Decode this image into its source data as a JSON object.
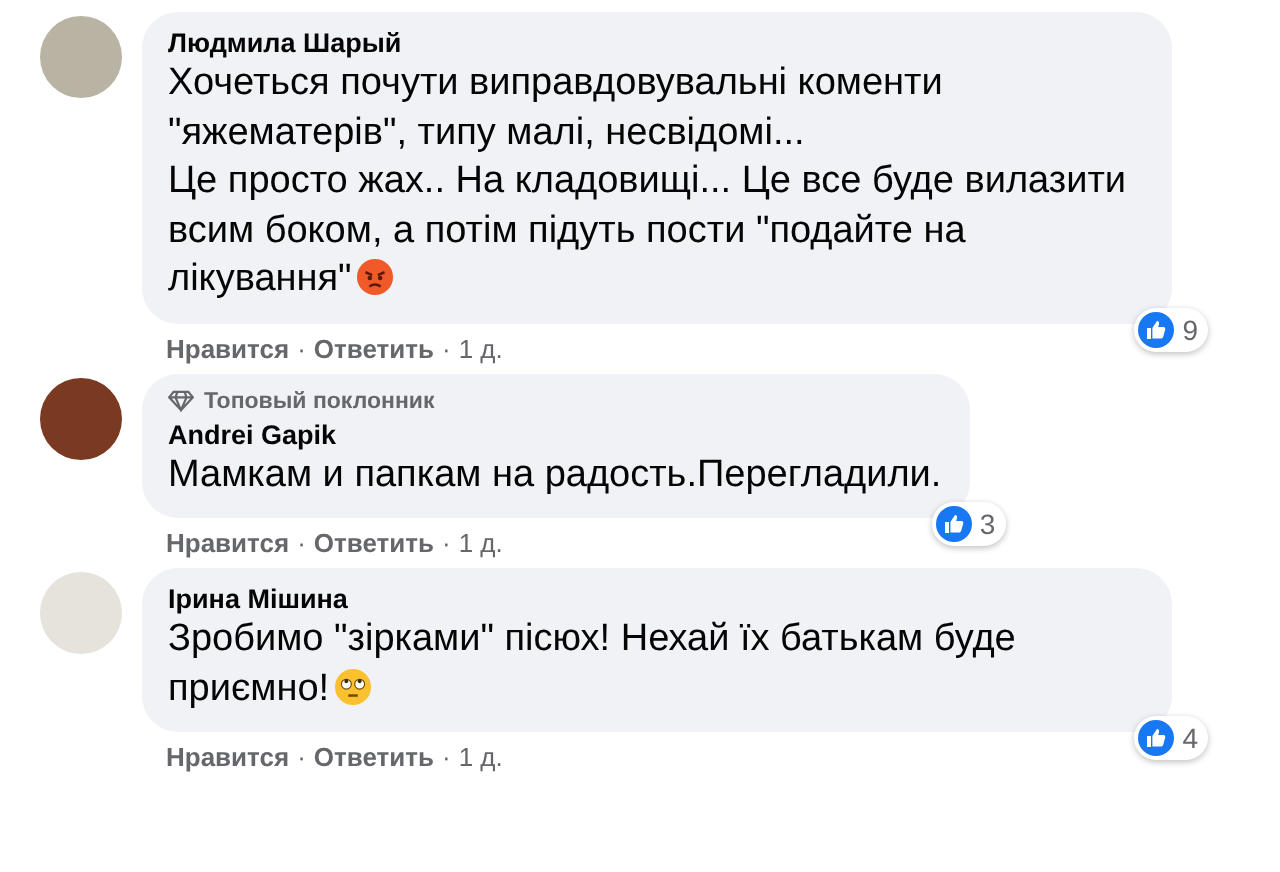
{
  "comments": [
    {
      "author": "Людмила Шарый",
      "paragraphs": [
        "Хочеться почути виправдовувальні коменти \"яжематерів\", типу малі, несвідомі...",
        "Це просто жах.. На кладовищі... Це все буде вилазити всим боком, а потім підуть пости \"подайте на лікування\""
      ],
      "emoji": {
        "kind": "angry"
      },
      "likes": "9",
      "actions": [
        "Нравится",
        "·",
        "Ответить",
        "·"
      ],
      "time": "1 д."
    },
    {
      "author": "Andrei Gapik",
      "badge": "Топовый поклонник",
      "paragraphs": [
        "Мамкам и папкам на радость.Перегладили."
      ],
      "likes": "3",
      "actions": [
        "Нравится",
        "·",
        "Ответить",
        "·"
      ],
      "time": "1 д."
    },
    {
      "author": "Ірина Мішина",
      "paragraphs": [
        "Зробимо \"зірками\" пісюх! Нехай їх батькам буде приємно!"
      ],
      "emoji": {
        "kind": "eyeroll"
      },
      "likes": "4",
      "actions": [
        "Нравится",
        "·",
        "Ответить",
        "·"
      ],
      "time": "1 д."
    }
  ]
}
